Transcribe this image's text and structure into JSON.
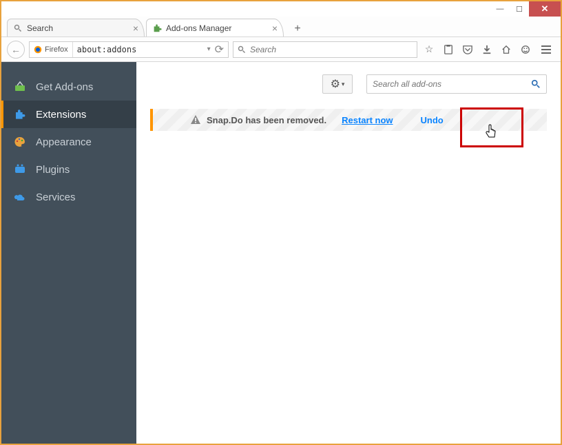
{
  "window": {
    "minimize": "—",
    "maximize": "☐",
    "close": "✕"
  },
  "tabs": [
    {
      "label": "Search",
      "active": false
    },
    {
      "label": "Add-ons Manager",
      "active": true
    }
  ],
  "newtab": "+",
  "navbar": {
    "back": "←",
    "identity_label": "Firefox",
    "url": "about:addons",
    "dropdown": "▾",
    "reload": "⟳",
    "search_placeholder": "Search",
    "search_icon": "🔍"
  },
  "toolbar_icons": {
    "star": "☆",
    "clipboard": "▭",
    "pocket": "⌄",
    "download": "↓",
    "home": "⌂",
    "smile": "☺"
  },
  "sidebar": {
    "items": [
      {
        "label": "Get Add-ons"
      },
      {
        "label": "Extensions"
      },
      {
        "label": "Appearance"
      },
      {
        "label": "Plugins"
      },
      {
        "label": "Services"
      }
    ],
    "active_index": 1
  },
  "main": {
    "gear": "⚙",
    "gear_caret": "▾",
    "addon_search_placeholder": "Search all add-ons",
    "notification": {
      "warn": "⚠",
      "message": "Snap.Do has been removed.",
      "restart": "Restart now",
      "undo": "Undo"
    }
  }
}
